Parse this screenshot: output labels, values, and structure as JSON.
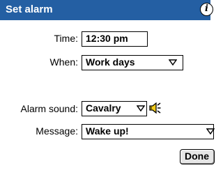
{
  "titlebar": {
    "title": "Set alarm",
    "info_icon_glyph": "i"
  },
  "time": {
    "label": "Time:",
    "value": "12:30 pm"
  },
  "when": {
    "label": "When:",
    "value": "Work days",
    "icon": "triangle-down-icon"
  },
  "alarm_sound": {
    "label": "Alarm sound:",
    "value": "Cavalry",
    "icon": "triangle-down-icon",
    "play_icon": "speaker-icon"
  },
  "message": {
    "label": "Message:",
    "value": "Wake up!"
  },
  "done_label": "Done",
  "colors": {
    "titlebar": "#245fa3",
    "icon_yellow": "#f2cc1a"
  }
}
